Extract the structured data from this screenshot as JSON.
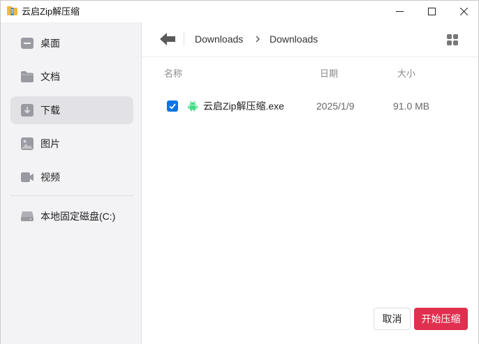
{
  "window": {
    "title": "云启Zip解压缩"
  },
  "sidebar": {
    "items": [
      {
        "label": "桌面",
        "icon": "desktop-icon",
        "active": false
      },
      {
        "label": "文档",
        "icon": "folder-icon",
        "active": false
      },
      {
        "label": "下载",
        "icon": "download-icon",
        "active": true
      },
      {
        "label": "图片",
        "icon": "image-icon",
        "active": false
      },
      {
        "label": "视频",
        "icon": "video-icon",
        "active": false
      }
    ],
    "drives": [
      {
        "label": "本地固定磁盘(C:)",
        "icon": "drive-icon"
      }
    ]
  },
  "pathbar": {
    "crumbs": [
      "Downloads",
      "Downloads"
    ]
  },
  "file_list": {
    "columns": {
      "name": "名称",
      "date": "日期",
      "size": "大小"
    },
    "rows": [
      {
        "name": "云启Zip解压缩.exe",
        "date": "2025/1/9",
        "size": "91.0 MB",
        "checked": true,
        "icon": "android-icon"
      }
    ]
  },
  "actions": {
    "cancel": "取消",
    "start": "开始压缩"
  },
  "colors": {
    "accent": "#e0304f",
    "checkbox": "#0a73e6",
    "file_icon": "#3ddc84",
    "sidebar_bg": "#f3f3f5",
    "active_item_bg": "#e2e2e6"
  }
}
